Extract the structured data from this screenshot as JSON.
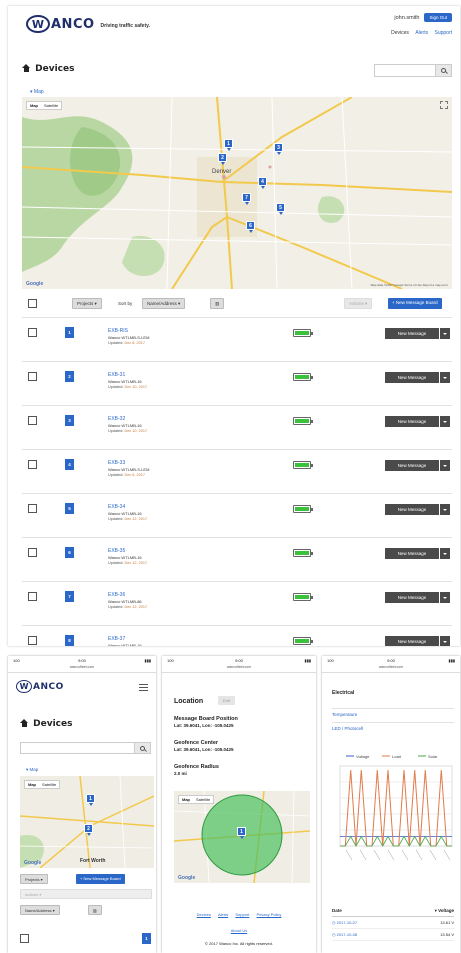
{
  "brand": {
    "logo_letter": "W",
    "logo_text": "ANCO",
    "tagline": "Driving traffic safety."
  },
  "header": {
    "user": "john.smith",
    "sign_out": "Sign Out",
    "links": [
      "Devices",
      "Alerts",
      "Support"
    ]
  },
  "page": {
    "title": "Devices",
    "search_placeholder": "",
    "map_toggle_label": "Map"
  },
  "map": {
    "toggle_options": [
      "Map",
      "Satellite"
    ],
    "provider": "Google",
    "footer": "Map data ©2017 Google  Terms of Use  Report a map error",
    "city_label": "Denver"
  },
  "toolbar": {
    "projects": "Projects",
    "sort_by": "Sort by",
    "sort_value": "Name/Address",
    "actions": "Actions",
    "new_board": "+ New Message Board"
  },
  "devices": [
    {
      "badge": "1",
      "name": "EXB-RIS",
      "model": "Wanco WTLMB-S-LEM",
      "updated_label": "Updated:",
      "updated": "Dec 6, 2017",
      "battery_pct": 100,
      "action": "New Message"
    },
    {
      "badge": "2",
      "name": "EXB-31",
      "model": "Wanco WTLMB-16",
      "updated_label": "Updated:",
      "updated": "Dec 10, 2017",
      "battery_pct": 100,
      "action": "New Message"
    },
    {
      "badge": "3",
      "name": "EXB-32",
      "model": "Wanco WTLMB-16",
      "updated_label": "Updated:",
      "updated": "Dec 10, 2017",
      "battery_pct": 100,
      "action": "New Message"
    },
    {
      "badge": "4",
      "name": "EXB-33",
      "model": "Wanco WTLMB-S-LEM",
      "updated_label": "Updated:",
      "updated": "Dec 6, 2017",
      "battery_pct": 100,
      "action": "New Message"
    },
    {
      "badge": "5",
      "name": "EXB-34",
      "model": "Wanco WTLMB-16",
      "updated_label": "Updated:",
      "updated": "Dec 12, 2017",
      "battery_pct": 100,
      "action": "New Message"
    },
    {
      "badge": "6",
      "name": "EXB-35",
      "model": "Wanco WTLMB-16",
      "updated_label": "Updated:",
      "updated": "Dec 12, 2017",
      "battery_pct": 100,
      "action": "New Message"
    },
    {
      "badge": "7",
      "name": "EXB-36",
      "model": "Wanco WTLMB-86",
      "updated_label": "Updated:",
      "updated": "Dec 12, 2017",
      "battery_pct": 100,
      "action": "New Message"
    },
    {
      "badge": "8",
      "name": "EXB-37",
      "model": "Wanco WTLMB-16",
      "updated_label": "Updated:",
      "updated": "Dec 12, 2017",
      "battery_pct": 100,
      "action": "New Message"
    }
  ],
  "map_pins": [
    "1",
    "2",
    "3",
    "4",
    "5",
    "6",
    "7"
  ],
  "phone_status": {
    "time": "9:00",
    "carrier": "100",
    "url": "wancofleet.com",
    "signal": ""
  },
  "phone1": {
    "title": "Devices",
    "map_label": "Map",
    "city": "Fort Worth",
    "projects": "Projects",
    "new_board": "+ New Message Board",
    "actions": "Actions",
    "sort_value": "Name/Address",
    "badge": "1"
  },
  "phone2": {
    "location_title": "Location",
    "edit": "Edit",
    "board_position_label": "Message Board Position",
    "board_position": "Lat: 39.6041, Lon: -105.0425",
    "geofence_center_label": "Geofence Center",
    "geofence_center": "Lat: 39.6041, Lon: -105.0425",
    "geofence_radius_label": "Geofence Radius",
    "geofence_radius": "2.0 mi",
    "footer_links": [
      "Devices",
      "Alerts",
      "Support",
      "Privacy Policy"
    ],
    "about": "About Us",
    "copyright": "© 2017 Wanco Inc. All rights reserved."
  },
  "phone3": {
    "heading": "Electrical",
    "rows": [
      "Temperature",
      "LED / Photocell"
    ],
    "legend": [
      "Voltage",
      "Load",
      "Solar"
    ],
    "table_headers": [
      "Date",
      "Voltage"
    ],
    "table_rows": [
      {
        "date": "2017-10-07",
        "value": "13.61 V"
      },
      {
        "date": "2017-10-08",
        "value": "13.54 V"
      }
    ]
  },
  "chart_data": {
    "type": "line",
    "title": "",
    "xlabel": "",
    "ylabel": "",
    "series": [
      {
        "name": "Voltage",
        "values": [
          1,
          1,
          1,
          1,
          1,
          1,
          1,
          1,
          1,
          1,
          1,
          1,
          1,
          1,
          1,
          1,
          1,
          1,
          1,
          1,
          1,
          1
        ]
      },
      {
        "name": "Load",
        "values": [
          0,
          0,
          8,
          0,
          8,
          0,
          0,
          8,
          0,
          8,
          0,
          0,
          8,
          0,
          8,
          0,
          8,
          0,
          0,
          8,
          0,
          0
        ]
      },
      {
        "name": "Solar",
        "values": [
          0,
          0,
          1,
          0,
          1,
          0,
          0,
          1,
          0,
          1,
          0,
          0,
          1,
          0,
          1,
          0,
          1,
          0,
          0,
          1,
          0,
          0
        ]
      }
    ],
    "colors": {
      "Voltage": "#3a5ccf",
      "Load": "#e07a4a",
      "Solar": "#4aa84a"
    }
  },
  "colors": {
    "accent": "#2b67c8",
    "brand": "#1f2f6b",
    "battery": "#3ac23a",
    "dark_button": "#4a4a4a"
  }
}
